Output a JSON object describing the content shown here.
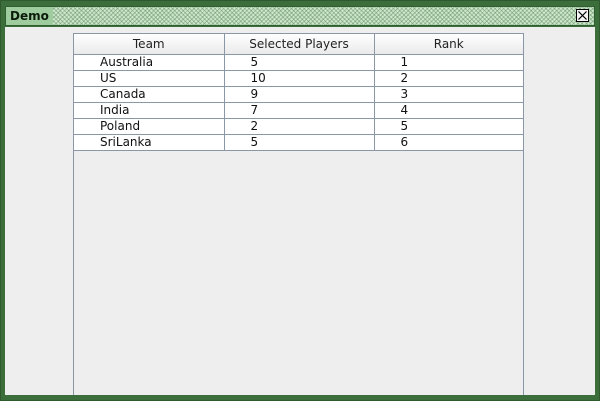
{
  "window": {
    "title": "Demo"
  },
  "table": {
    "headers": [
      "Team",
      "Selected Players",
      "Rank"
    ],
    "rows": [
      [
        "Australia",
        "5",
        "1"
      ],
      [
        "US",
        "10",
        "2"
      ],
      [
        "Canada",
        "9",
        "3"
      ],
      [
        "India",
        "7",
        "4"
      ],
      [
        "Poland",
        "2",
        "5"
      ],
      [
        "SriLanka",
        "5",
        "6"
      ]
    ]
  },
  "colors": {
    "window_frame": "#3b6e3b",
    "title_label_bg": "#9fcc9f",
    "content_bg": "#eeeeee",
    "grid_line": "#8a97a6"
  }
}
